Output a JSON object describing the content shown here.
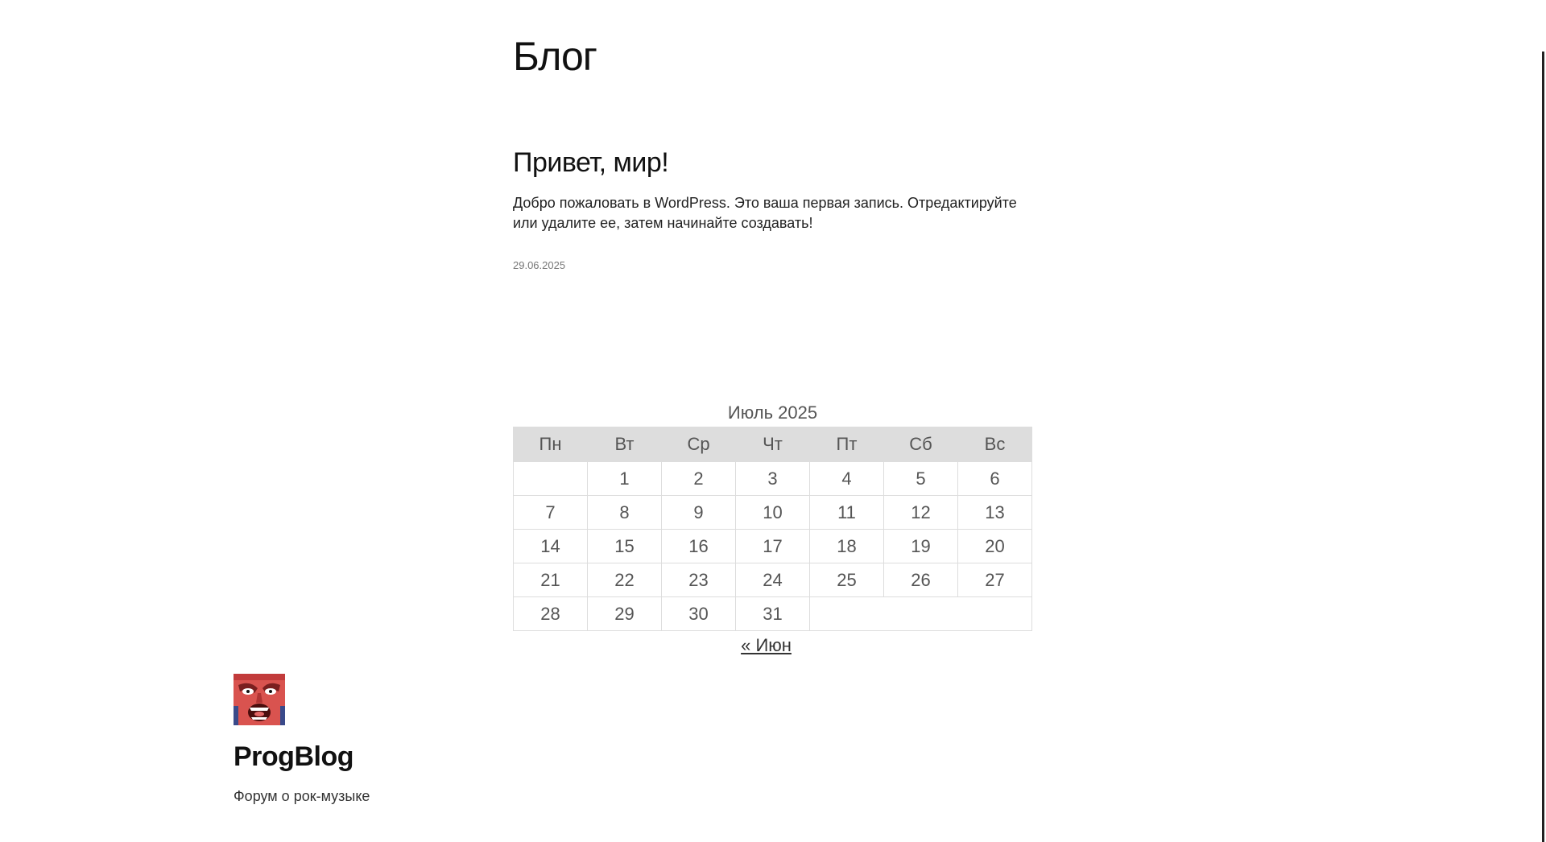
{
  "page": {
    "title": "Блог"
  },
  "post": {
    "title": "Привет, мир!",
    "excerpt": "Добро пожаловать в WordPress. Это ваша первая запись. Отредактируйте или удалите ее, затем начинайте создавать!",
    "date": "29.06.2025"
  },
  "calendar": {
    "caption": "Июль 2025",
    "weekdays": [
      "Пн",
      "Вт",
      "Ср",
      "Чт",
      "Пт",
      "Сб",
      "Вс"
    ],
    "weeks": [
      [
        "",
        "1",
        "2",
        "3",
        "4",
        "5",
        "6"
      ],
      [
        "7",
        "8",
        "9",
        "10",
        "11",
        "12",
        "13"
      ],
      [
        "14",
        "15",
        "16",
        "17",
        "18",
        "19",
        "20"
      ],
      [
        "21",
        "22",
        "23",
        "24",
        "25",
        "26",
        "27"
      ],
      [
        "28",
        "29",
        "30",
        "31",
        "",
        "",
        ""
      ]
    ],
    "prev_link": "« Июн"
  },
  "site": {
    "logo_icon": "album-cover-screaming-face-icon",
    "name": "ProgBlog",
    "tagline": "Форум о рок-музыке"
  },
  "colors": {
    "header_bg": "#dddddd",
    "logo_face": "#d9534f"
  }
}
